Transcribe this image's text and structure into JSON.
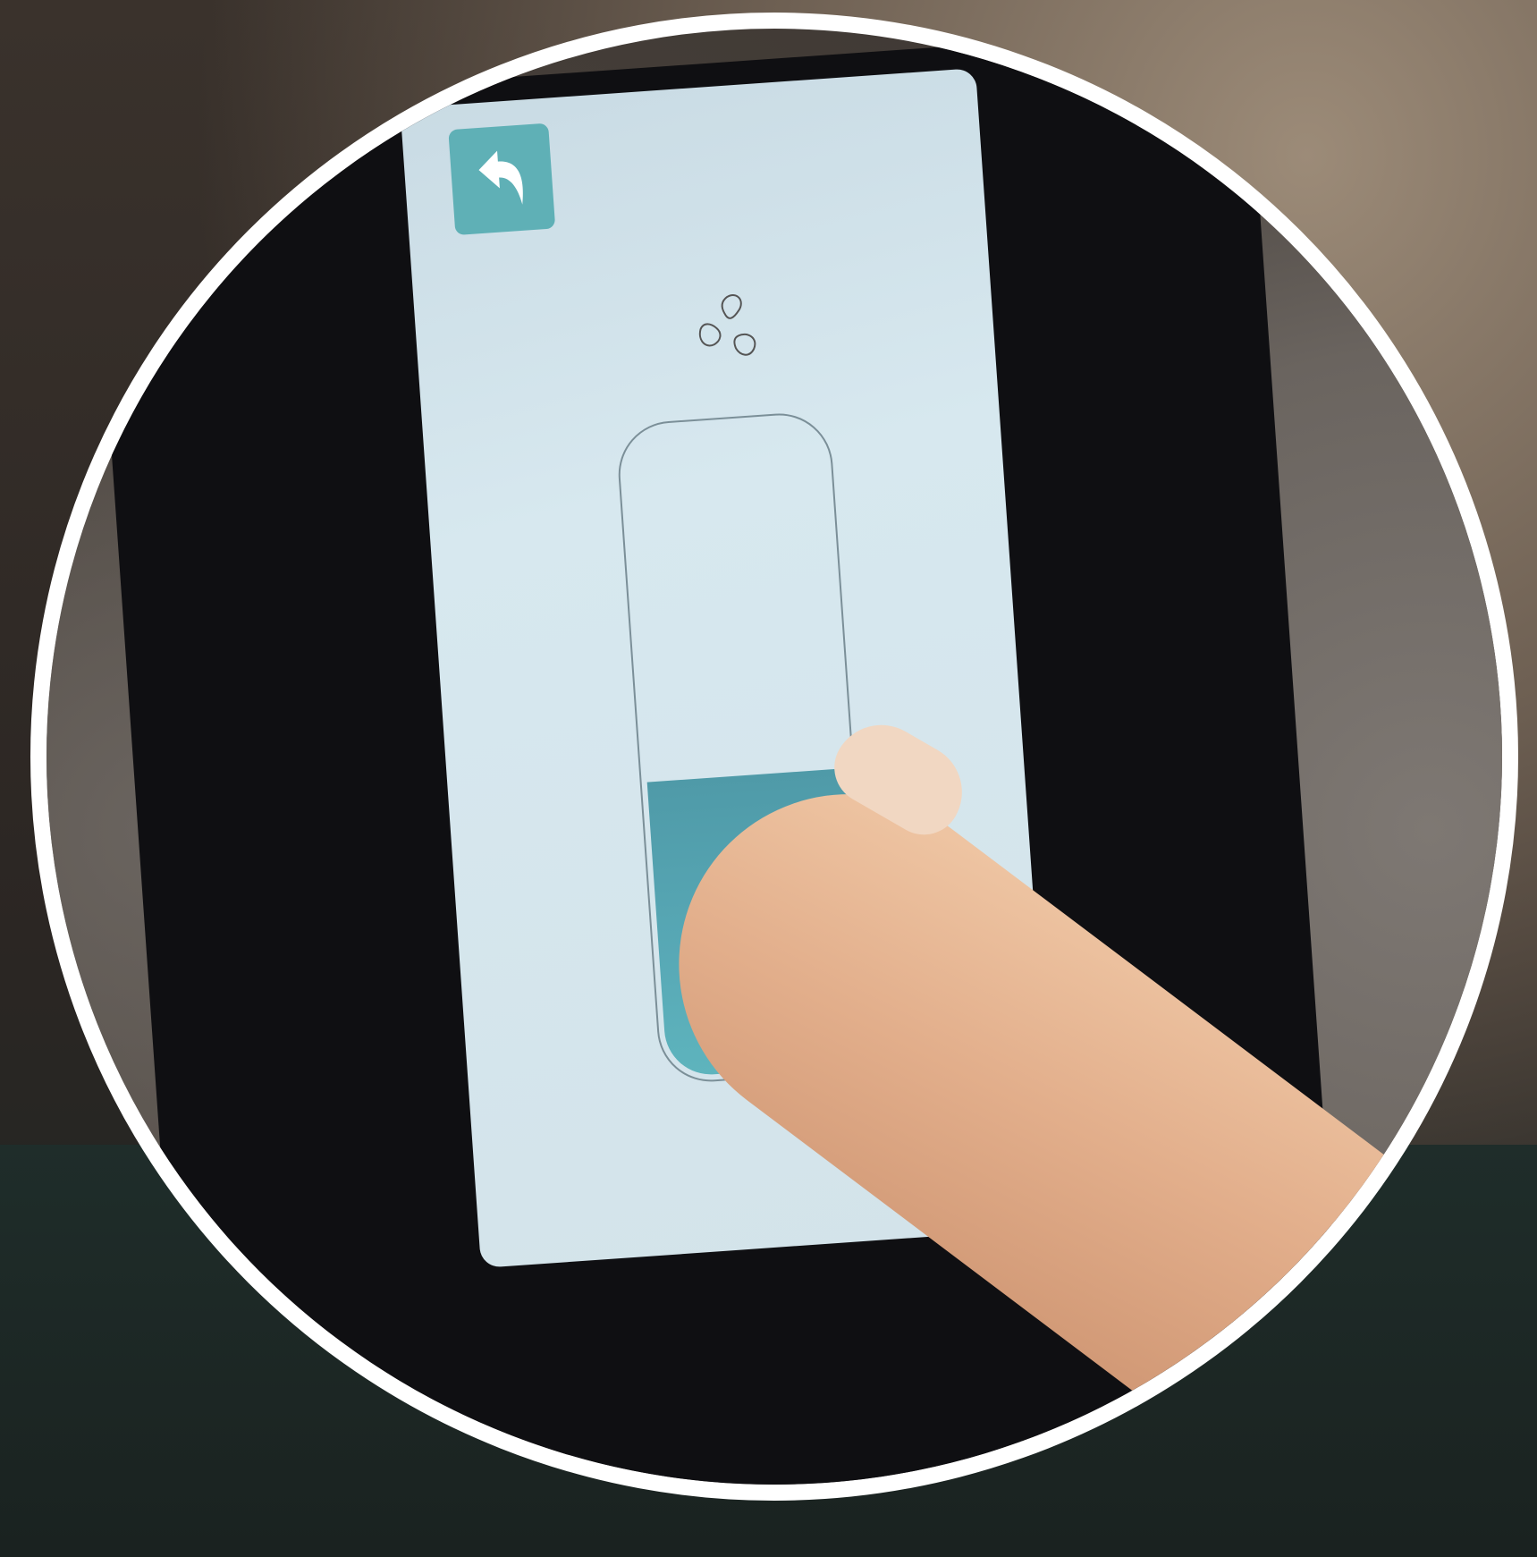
{
  "screen": {
    "back_button": {
      "icon": "back-arrow-icon"
    },
    "mode_icon": "fan-icon",
    "fan_speed_slider": {
      "level_fraction": 0.45
    }
  },
  "colors": {
    "accent": "#5fb0b6",
    "screen_bg": "#d3e3ea",
    "slider_fill": "#58a9b6",
    "slider_outline": "#7b8f98"
  }
}
